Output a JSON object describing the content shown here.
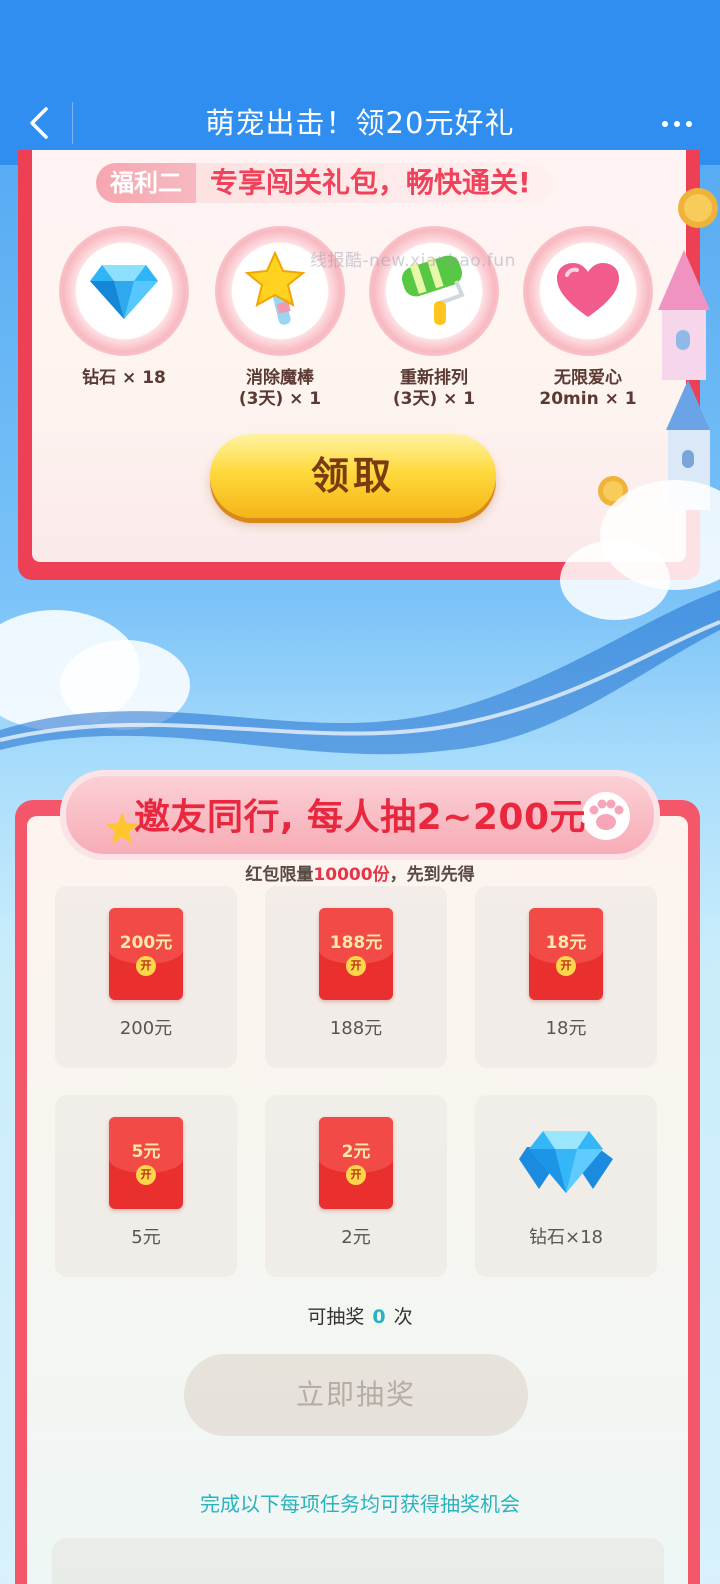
{
  "header": {
    "title": "萌宠出击！领20元好礼",
    "back_icon": "chevron-left-icon",
    "more_icon": "more-dots-icon"
  },
  "welfare": {
    "tag": "福利二",
    "desc": "专享闯关礼包，畅快通关!",
    "watermark": "线报酷-new.xianbao.fun",
    "gifts": [
      {
        "icon": "diamond-icon",
        "line1": "钻石 × 18",
        "line2": ""
      },
      {
        "icon": "magic-wand-icon",
        "line1": "消除魔棒",
        "line2": "(3天) × 1"
      },
      {
        "icon": "shuffle-roller-icon",
        "line1": "重新排列",
        "line2": "(3天)  × 1"
      },
      {
        "icon": "heart-icon",
        "line1": "无限爱心",
        "line2": "20min × 1"
      }
    ],
    "claim_label": "领取"
  },
  "lottery": {
    "banner": "邀友同行, 每人抽2~200元",
    "limit_prefix": "红包限量",
    "limit_count": "10000份",
    "limit_suffix": "，先到先得",
    "prizes": [
      {
        "badge": "200元",
        "label": "200元",
        "seal": "开"
      },
      {
        "badge": "188元",
        "label": "188元",
        "seal": "开"
      },
      {
        "badge": "18元",
        "label": "18元",
        "seal": "开"
      },
      {
        "badge": "5元",
        "label": "5元",
        "seal": "开"
      },
      {
        "badge": "2元",
        "label": "2元",
        "seal": "开"
      },
      {
        "badge": "",
        "label": "钻石×18",
        "seal": ""
      }
    ],
    "draw_prefix": "可抽奖",
    "draw_count": "0",
    "draw_suffix": "次",
    "draw_button": "立即抽奖",
    "task_note": "完成以下每项任务均可获得抽奖机会"
  },
  "colors": {
    "topbar": "#2f8ef0",
    "panel_border": "#ee4055",
    "accent_red": "#e9283f",
    "teal": "#2ab3bf",
    "gold": "#ffd93c"
  }
}
